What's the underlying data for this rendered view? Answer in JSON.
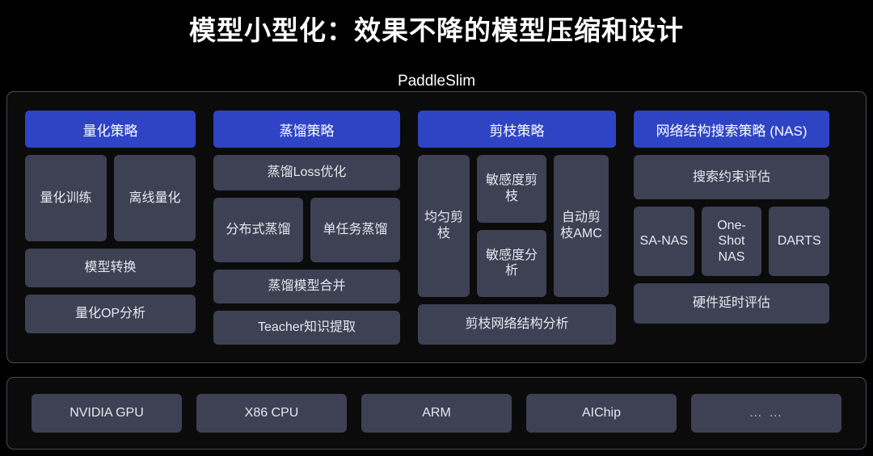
{
  "slide": {
    "title": "模型小型化：效果不降的模型压缩和设计",
    "framework_label": "PaddleSlim",
    "accent_color": "#2e44c4",
    "card_color": "#3d4153",
    "background_color": "#000000",
    "border_color": "#4a4d57"
  },
  "columns": [
    {
      "header": "量化策略",
      "items": {
        "quant_training": "量化训练",
        "offline_quant": "离线量化",
        "model_convert": "模型转换",
        "quant_op_analysis": "量化OP分析"
      }
    },
    {
      "header": "蒸馏策略",
      "items": {
        "distill_loss_opt": "蒸馏Loss优化",
        "distributed_distill": "分布式蒸馏",
        "single_task_distill": "单任务蒸馏",
        "distill_model_merge": "蒸馏模型合并",
        "teacher_knowledge": "Teacher知识提取"
      }
    },
    {
      "header": "剪枝策略",
      "items": {
        "uniform_prune": "均匀剪枝",
        "sensitivity_prune": "敏感度剪枝",
        "sensitivity_analysis": "敏感度分析",
        "auto_prune_amc": "自动剪枝AMC",
        "prune_net_analysis": "剪枝网络结构分析"
      }
    },
    {
      "header": "网络结构搜索策略 (NAS)",
      "items": {
        "search_constraint_eval": "搜索约束评估",
        "sa_nas": "SA-NAS",
        "one_shot_nas": "One-Shot NAS",
        "darts": "DARTS",
        "hardware_latency_eval": "硬件延时评估"
      }
    }
  ],
  "hardware": {
    "items": [
      {
        "label": "NVIDIA GPU"
      },
      {
        "label": "X86 CPU"
      },
      {
        "label": "ARM"
      },
      {
        "label": "AIChip"
      },
      {
        "label": "… …"
      }
    ]
  }
}
